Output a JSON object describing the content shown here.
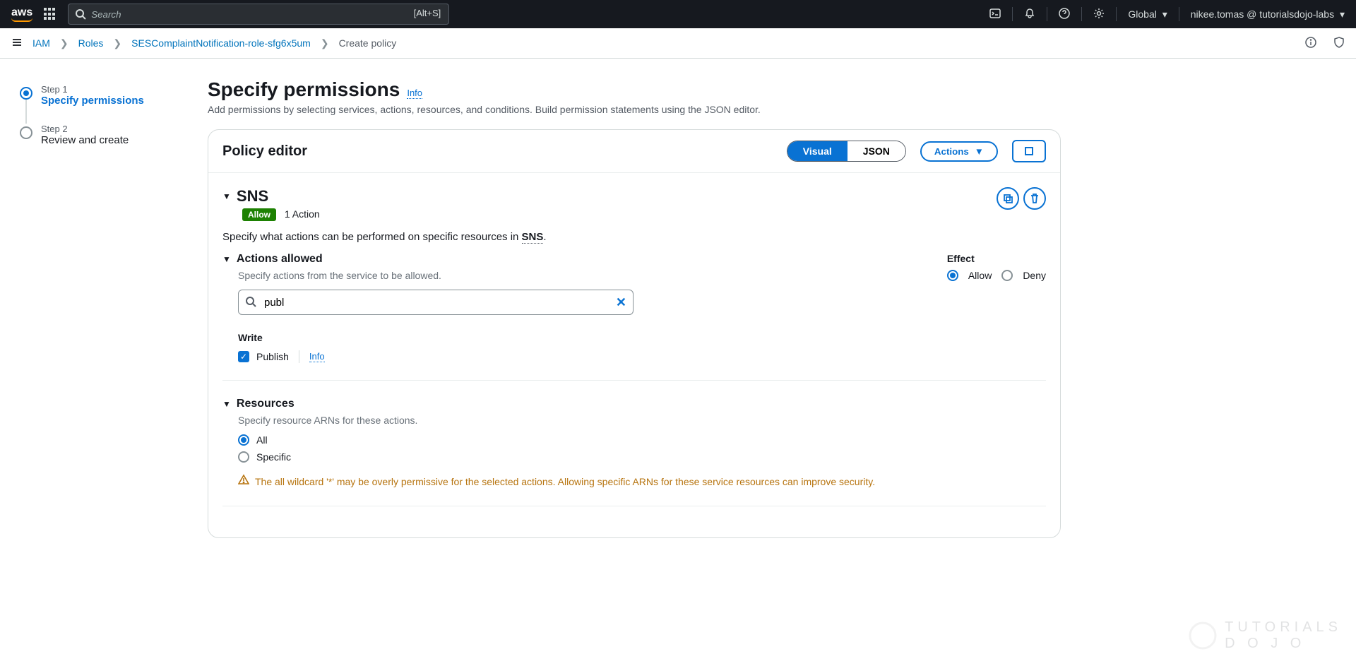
{
  "topnav": {
    "logo": "aws",
    "search_placeholder": "Search",
    "search_kbd": "[Alt+S]",
    "region": "Global",
    "account": "nikee.tomas @ tutorialsdojo-labs"
  },
  "breadcrumb": {
    "items": [
      "IAM",
      "Roles",
      "SESComplaintNotification-role-sfg6x5um",
      "Create policy"
    ]
  },
  "steps": [
    {
      "label_small": "Step 1",
      "label": "Specify permissions",
      "active": true
    },
    {
      "label_small": "Step 2",
      "label": "Review and create",
      "active": false
    }
  ],
  "page": {
    "title": "Specify permissions",
    "info": "Info",
    "desc": "Add permissions by selecting services, actions, resources, and conditions. Build permission statements using the JSON editor."
  },
  "editor": {
    "title": "Policy editor",
    "toggle": {
      "visual": "Visual",
      "json": "JSON"
    },
    "actions_btn": "Actions"
  },
  "statement": {
    "service": "SNS",
    "effect_badge": "Allow",
    "action_count": "1 Action",
    "desc_prefix": "Specify what actions can be performed on specific resources in ",
    "desc_service": "SNS",
    "actions_section": {
      "title": "Actions allowed",
      "help": "Specify actions from the service to be allowed.",
      "search_value": "publ",
      "write_label": "Write",
      "publish_label": "Publish",
      "info": "Info"
    },
    "effect": {
      "title": "Effect",
      "allow": "Allow",
      "deny": "Deny",
      "selected": "Allow"
    },
    "resources": {
      "title": "Resources",
      "help": "Specify resource ARNs for these actions.",
      "all": "All",
      "specific": "Specific",
      "selected": "All",
      "warning": "The all wildcard '*' may be overly permissive for the selected actions. Allowing specific ARNs for these service resources can improve security."
    }
  },
  "watermark": {
    "line1": "TUTORIALS",
    "line2": "D O J O"
  }
}
